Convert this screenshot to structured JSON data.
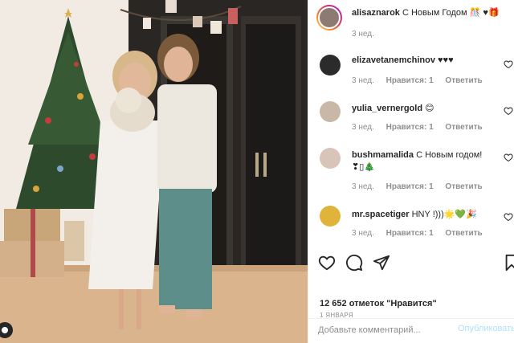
{
  "post": {
    "author": "alisaznarok",
    "caption": "С Новым Годом 🎊 ♥🎁",
    "age": "3 нед."
  },
  "comments": [
    {
      "user": "elizavetanemchinov",
      "text": "♥♥♥",
      "age": "3 нед.",
      "likes": "Нравится: 1",
      "reply": "Ответить"
    },
    {
      "user": "yulia_vernergold",
      "text": "😊",
      "age": "3 нед.",
      "likes": "Нравится: 1",
      "reply": "Ответить"
    },
    {
      "user": "bushmamalida",
      "text": "С Новым годом!",
      "text2": "❣▯🎄",
      "age": "3 нед.",
      "likes": "Нравится: 1",
      "reply": "Ответить"
    },
    {
      "user": "mr.spacetiger",
      "text": "HNY !)))🌟💚🎉",
      "age": "3 нед.",
      "likes": "Нравится: 1",
      "reply": "Ответить"
    }
  ],
  "stats": {
    "likes": "12 652 отметок \"Нравится\"",
    "date": "1 января"
  },
  "composer": {
    "placeholder": "Добавьте комментарий...",
    "publish": "Опубликовать"
  },
  "icons": {
    "like": "heart-icon",
    "comment": "comment-icon",
    "share": "share-icon",
    "save": "bookmark-icon"
  },
  "colors": {
    "muted": "#8e8e8e",
    "text": "#262626",
    "publish_disabled": "#b2dffc",
    "border": "#efefef"
  }
}
